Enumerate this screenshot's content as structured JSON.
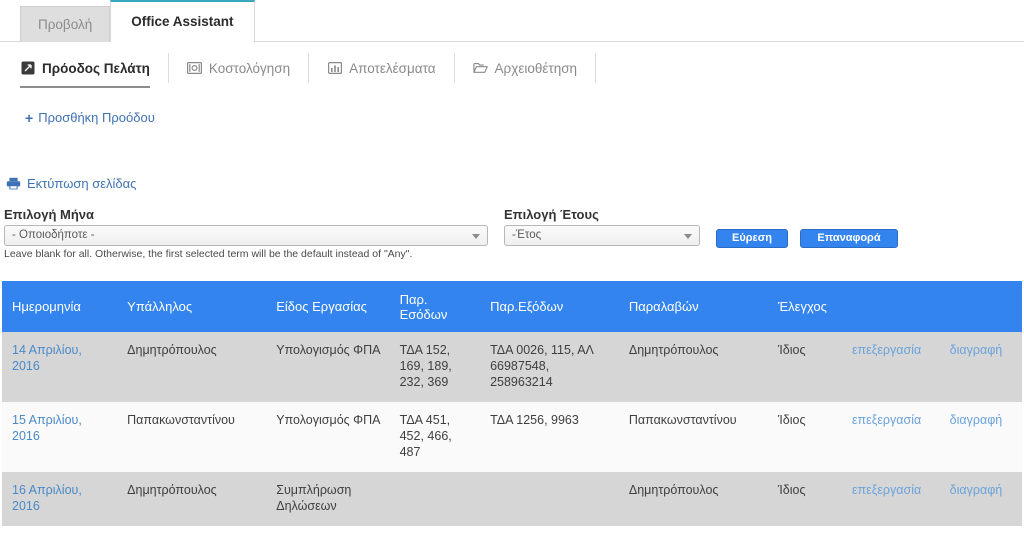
{
  "primary_tabs": [
    {
      "label": "Προβολή",
      "active": false
    },
    {
      "label": "Office Assistant",
      "active": true
    }
  ],
  "secondary_tabs": [
    {
      "label": "Πρόοδος Πελάτη",
      "icon": "expand-arrow-icon",
      "active": true
    },
    {
      "label": "Κοστολόγηση",
      "icon": "money-icon",
      "active": false
    },
    {
      "label": "Αποτελέσματα",
      "icon": "bar-chart-icon",
      "active": false
    },
    {
      "label": "Αρχειοθέτηση",
      "icon": "folder-icon",
      "active": false
    }
  ],
  "actions": {
    "add_progress": "Προσθήκη Προόδου",
    "add_progress_plus": "+",
    "print_page": "Εκτύπωση σελίδας"
  },
  "filters": {
    "month": {
      "label": "Επιλογή Μήνα",
      "value": "- Οποιοδήποτε -",
      "help": "Leave blank for all. Otherwise, the first selected term will be the default instead of \"Any\"."
    },
    "year": {
      "label": "Επιλογή Έτους",
      "value": "-Έτος"
    },
    "search_button": "Εύρεση",
    "reset_button": "Επαναφορά"
  },
  "table": {
    "columns": [
      "Ημερομηνία",
      "Υπάλληλος",
      "Είδος Εργασίας",
      "Παρ. Εσόδων",
      "Παρ.Εξόδων",
      "Παραλαβών",
      "Έλεγχος",
      "",
      ""
    ],
    "edit_label": "επεξεργασία",
    "delete_label": "διαγραφή",
    "rows": [
      {
        "date": "14 Απριλίου, 2016",
        "employee": "Δημητρόπουλος",
        "kind": "Υπολογισμός ΦΠΑ",
        "income": "ΤΔΑ 152, 169, 189, 232, 369",
        "expenses": "ΤΔΑ 0026, 115, ΑΛ 66987548, 258963214",
        "receipts": "Δημητρόπουλος",
        "check": "Ίδιος"
      },
      {
        "date": "15 Απριλίου, 2016",
        "employee": "Παπακωνσταντίνου",
        "kind": "Υπολογισμός ΦΠΑ",
        "income": "ΤΔΑ 451, 452, 466, 487",
        "expenses": "ΤΔΑ 1256, 9963",
        "receipts": "Παπακωνσταντίνου",
        "check": "Ίδιος"
      },
      {
        "date": "16 Απριλίου, 2016",
        "employee": "Δημητρόπουλος",
        "kind": "Συμπλήρωση Δηλώσεων",
        "income": "",
        "expenses": "",
        "receipts": "Δημητρόπουλος",
        "check": "Ίδιος"
      }
    ]
  },
  "colors": {
    "accent_blue": "#3384ee",
    "active_tab_top": "#3aa9bd",
    "link_blue": "#4a89c8",
    "row_odd": "#d6d6d6",
    "row_even": "#fafafa"
  }
}
